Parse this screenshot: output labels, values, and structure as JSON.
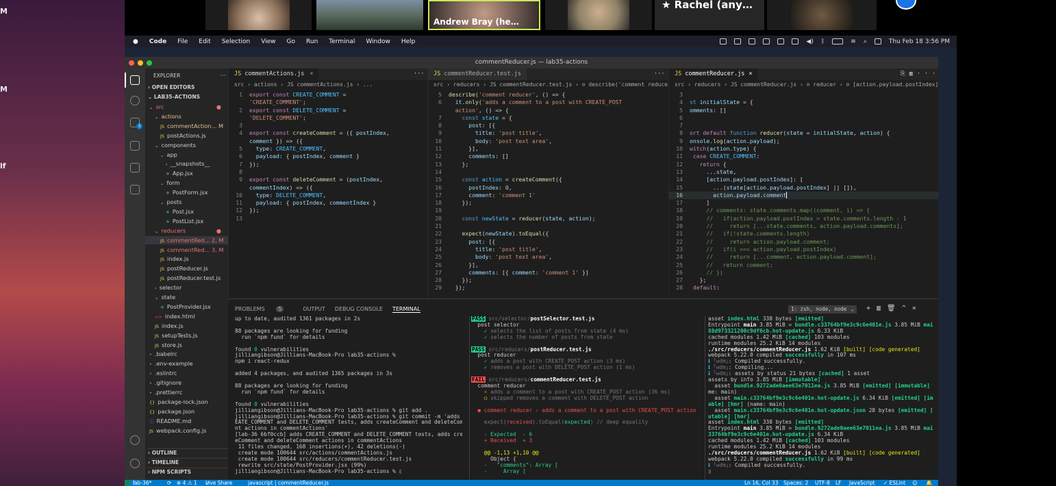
{
  "video_strip": {
    "tiles": [
      {
        "name": ""
      },
      {
        "name": ""
      },
      {
        "name": "Andrew Bray (he…"
      },
      {
        "name": ""
      },
      {
        "name": "Rachel (any…"
      },
      {
        "name": ""
      }
    ]
  },
  "desktop": {
    "labels": [
      "M",
      "M",
      "lf"
    ]
  },
  "menubar": {
    "app": "Code",
    "items": [
      "File",
      "Edit",
      "Selection",
      "View",
      "Go",
      "Run",
      "Terminal",
      "Window",
      "Help"
    ],
    "clock": "Thu Feb 18  3:56 PM"
  },
  "window": {
    "title": "commentReducer.js — lab35-actions"
  },
  "explorer": {
    "title": "EXPLORER",
    "open_editors": "OPEN EDITORS",
    "project": "LAB35-ACTIONS",
    "tree": [
      {
        "label": "src",
        "depth": 0,
        "kind": "folder-open",
        "status": "red-dot"
      },
      {
        "label": "actions",
        "depth": 1,
        "kind": "folder-open",
        "status": "m-color"
      },
      {
        "label": "commentAction...  M",
        "depth": 2,
        "kind": "js",
        "status": "m"
      },
      {
        "label": "postActions.js",
        "depth": 2,
        "kind": "js",
        "status": ""
      },
      {
        "label": "components",
        "depth": 1,
        "kind": "folder-open",
        "status": ""
      },
      {
        "label": "app",
        "depth": 2,
        "kind": "folder-open",
        "status": ""
      },
      {
        "label": "__snapshots__",
        "depth": 3,
        "kind": "folder",
        "status": ""
      },
      {
        "label": "App.jsx",
        "depth": 3,
        "kind": "jsx",
        "status": ""
      },
      {
        "label": "form",
        "depth": 2,
        "kind": "folder-open",
        "status": ""
      },
      {
        "label": "PostForm.jsx",
        "depth": 3,
        "kind": "jsx",
        "status": ""
      },
      {
        "label": "posts",
        "depth": 2,
        "kind": "folder-open",
        "status": ""
      },
      {
        "label": "Post.jsx",
        "depth": 3,
        "kind": "jsx",
        "status": ""
      },
      {
        "label": "PostList.jsx",
        "depth": 3,
        "kind": "jsx",
        "status": ""
      },
      {
        "label": "reducers",
        "depth": 1,
        "kind": "folder-open",
        "status": "red"
      },
      {
        "label": "commentRed...  2, M",
        "depth": 2,
        "kind": "js",
        "status": "red"
      },
      {
        "label": "commentRed...  3, M",
        "depth": 2,
        "kind": "js",
        "status": "red"
      },
      {
        "label": "index.js",
        "depth": 2,
        "kind": "js",
        "status": ""
      },
      {
        "label": "postReducer.js",
        "depth": 2,
        "kind": "js",
        "status": ""
      },
      {
        "label": "postReducer.test.js",
        "depth": 2,
        "kind": "js",
        "status": ""
      },
      {
        "label": "selector",
        "depth": 1,
        "kind": "folder",
        "status": ""
      },
      {
        "label": "state",
        "depth": 1,
        "kind": "folder-open",
        "status": ""
      },
      {
        "label": "PostProvider.jsx",
        "depth": 2,
        "kind": "jsx",
        "status": ""
      },
      {
        "label": "index.html",
        "depth": 1,
        "kind": "html",
        "status": ""
      },
      {
        "label": "index.js",
        "depth": 1,
        "kind": "js",
        "status": ""
      },
      {
        "label": "setupTests.js",
        "depth": 1,
        "kind": "js",
        "status": ""
      },
      {
        "label": "store.js",
        "depth": 1,
        "kind": "js",
        "status": ""
      },
      {
        "label": ".babelrc",
        "depth": 0,
        "kind": "file",
        "status": ""
      },
      {
        "label": ".env-example",
        "depth": 0,
        "kind": "file",
        "status": ""
      },
      {
        "label": ".eslintrc",
        "depth": 0,
        "kind": "file",
        "status": ""
      },
      {
        "label": ".gitignore",
        "depth": 0,
        "kind": "file",
        "status": ""
      },
      {
        "label": ".prettierrc",
        "depth": 0,
        "kind": "file",
        "status": ""
      },
      {
        "label": "package-lock.json",
        "depth": 0,
        "kind": "json",
        "status": ""
      },
      {
        "label": "package.json",
        "depth": 0,
        "kind": "json",
        "status": ""
      },
      {
        "label": "README.md",
        "depth": 0,
        "kind": "md",
        "status": ""
      },
      {
        "label": "webpack.config.js",
        "depth": 0,
        "kind": "js",
        "status": ""
      }
    ],
    "outline": "OUTLINE",
    "timeline": "TIMELINE",
    "npm": "NPM SCRIPTS"
  },
  "editor1": {
    "tab": "commentActions.js",
    "breadcrumb": "src › actions › JS commentActions.js › ..."
  },
  "editor2": {
    "tab": "commentReducer.test.js",
    "breadcrumb": "src › reducers › JS commentReducer.test.js › ⊙ describe('comment reducer') callback"
  },
  "editor3": {
    "tab": "commentReducer.js",
    "breadcrumb": "src › reducers › JS commentReducer.js › ⊙ reducer › ⊘ [action.payload.postIndex]"
  },
  "panel": {
    "tabs": [
      "PROBLEMS",
      "OUTPUT",
      "DEBUG CONSOLE",
      "TERMINAL"
    ],
    "problems_count": "5",
    "terminal_select": "1: zsh, node, node"
  },
  "status": {
    "branch": "lab-36*",
    "sync": "⟳",
    "errors": "⊗ 4 ⚠ 1",
    "liveshare": "Live Share",
    "lang_crumb": "javascript | commentReducer.js",
    "position": "Ln 16, Col 33",
    "spaces": "Spaces: 2",
    "encoding": "UTF-8",
    "eol": "LF",
    "language": "JavaScript",
    "eslint": "✓ ESLint"
  }
}
